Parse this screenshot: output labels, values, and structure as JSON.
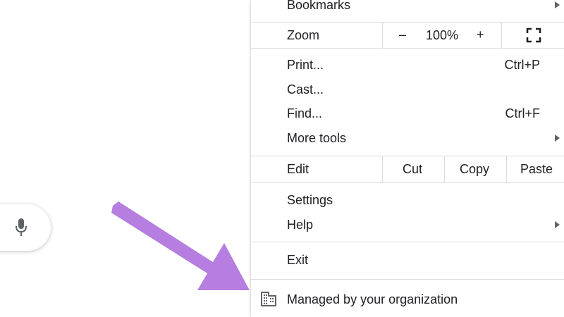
{
  "menu": {
    "bookmarks_label": "Bookmarks",
    "zoom": {
      "label": "Zoom",
      "minus": "–",
      "value": "100%",
      "plus": "+"
    },
    "print": {
      "label": "Print...",
      "shortcut": "Ctrl+P"
    },
    "cast": {
      "label": "Cast..."
    },
    "find": {
      "label": "Find...",
      "shortcut": "Ctrl+F"
    },
    "more_tools": {
      "label": "More tools"
    },
    "edit": {
      "label": "Edit",
      "cut": "Cut",
      "copy": "Copy",
      "paste": "Paste"
    },
    "settings": {
      "label": "Settings"
    },
    "help": {
      "label": "Help"
    },
    "exit": {
      "label": "Exit"
    },
    "managed": {
      "label": "Managed by your organization"
    }
  },
  "colors": {
    "annotation_arrow": "#b57ee0",
    "separator": "#dadce0",
    "text": "#202124"
  },
  "icons": [
    "mic-icon",
    "fullscreen-icon",
    "building-icon",
    "submenu-arrow-icon"
  ]
}
